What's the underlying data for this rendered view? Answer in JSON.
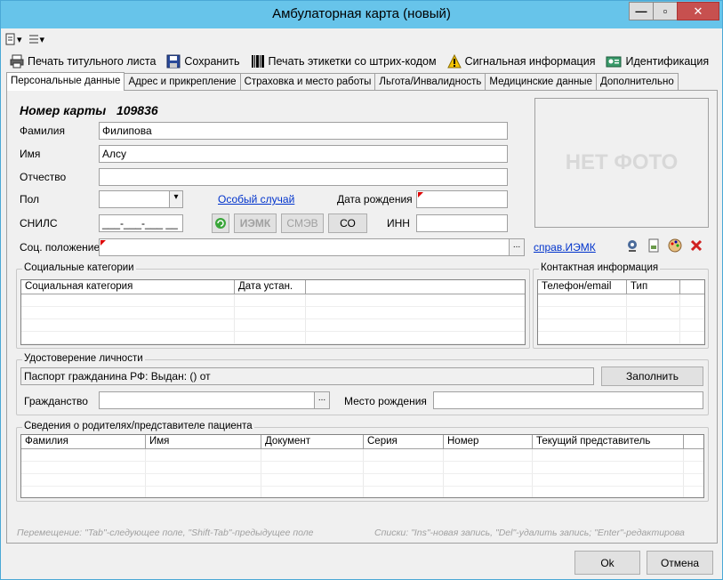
{
  "window": {
    "title": "Амбулаторная карта (новый)"
  },
  "toolbar": {
    "print_title": "Печать титульного листа",
    "save": "Сохранить",
    "print_barcode": "Печать этикетки со штрих-кодом",
    "signal_info": "Сигнальная информация",
    "identification": "Идентификация"
  },
  "tabs": [
    {
      "label": "Персональные данные"
    },
    {
      "label": "Адрес и прикрепление"
    },
    {
      "label": "Страховка и место работы"
    },
    {
      "label": "Льгота/Инвалидность"
    },
    {
      "label": "Медицинские данные"
    },
    {
      "label": "Дополнительно"
    }
  ],
  "card": {
    "number_label": "Номер карты",
    "number": "109836"
  },
  "fields": {
    "surname_label": "Фамилия",
    "surname": "Филипова",
    "name_label": "Имя",
    "name": "Алсу",
    "patronymic_label": "Отчество",
    "patronymic": "",
    "sex_label": "Пол",
    "sex": "",
    "special_case": "Особый случай",
    "birthdate_label": "Дата рождения",
    "snils_label": "СНИЛС",
    "snils": "___-___-___ __",
    "inn_label": "ИНН",
    "inn": "",
    "social_label": "Соц. положение",
    "social": "",
    "iemk_ref": "справ.ИЭМК"
  },
  "buttons": {
    "iemk": "ИЭМК",
    "smev": "СМЭВ",
    "co": "СО",
    "fill": "Заполнить",
    "ok": "Ok",
    "cancel": "Отмена"
  },
  "photo": {
    "placeholder": "НЕТ ФОТО"
  },
  "social_categories": {
    "title": "Социальные категории",
    "columns": [
      "Социальная категория",
      "Дата устан."
    ]
  },
  "contacts": {
    "title": "Контактная информация",
    "columns": [
      "Телефон/email",
      "Тип"
    ]
  },
  "identity": {
    "title": "Удостоверение личности",
    "document": "Паспорт гражданина РФ:   Выдан: () от",
    "citizenship_label": "Гражданство",
    "citizenship": "",
    "birthplace_label": "Место рождения",
    "birthplace": ""
  },
  "parents": {
    "title": "Сведения о родителях/представителе пациента",
    "columns": [
      "Фамилия",
      "Имя",
      "Документ",
      "Серия",
      "Номер",
      "Текущий представитель"
    ]
  },
  "hints": {
    "left": "Перемещение: \"Tab\"-следующее поле, \"Shift-Tab\"-предыдущее поле",
    "right": "Списки: \"Ins\"-новая запись, \"Del\"-удалить запись; \"Enter\"-редактирова"
  }
}
